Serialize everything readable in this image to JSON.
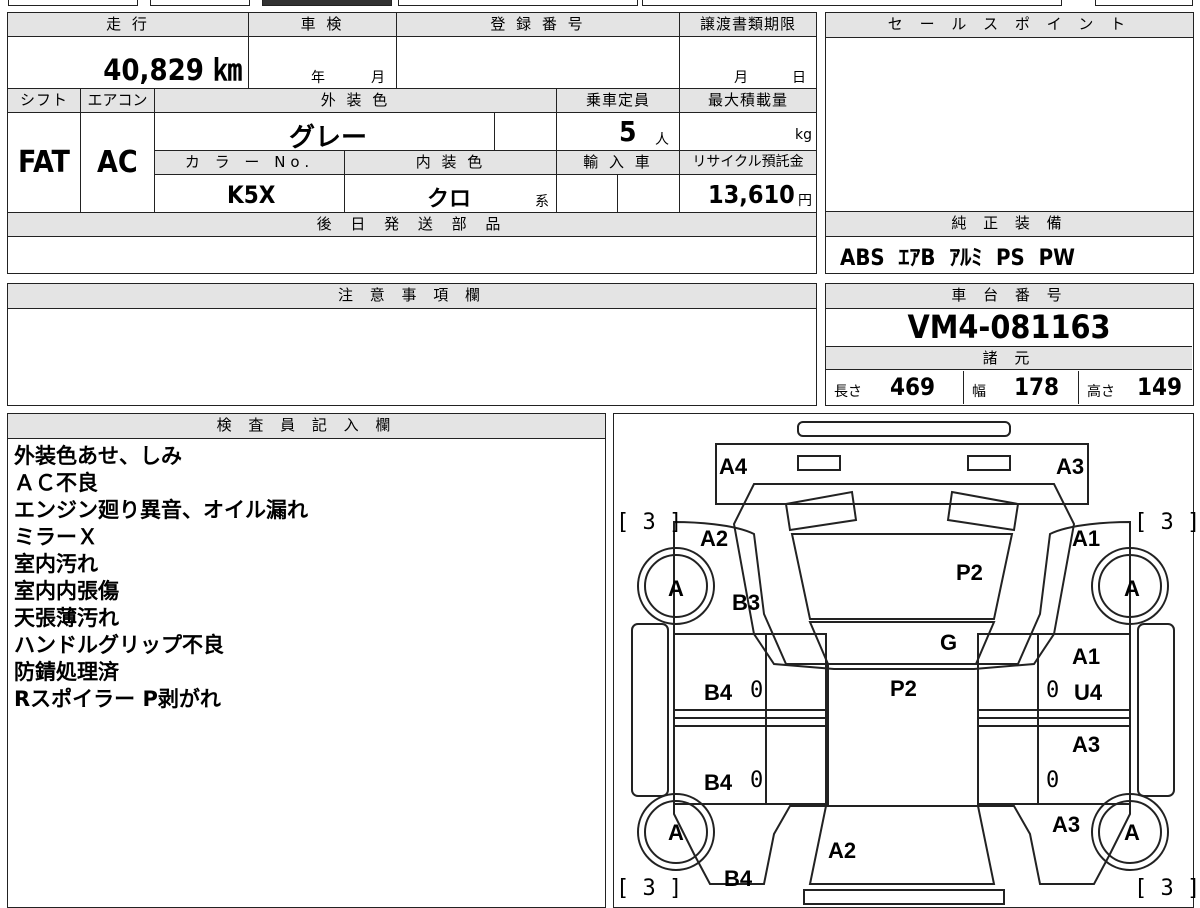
{
  "header": {
    "mileage_label": "走 行",
    "mileage_value": "40,829 ㎞",
    "shaken_label": "車 検",
    "shaken_year": "年",
    "shaken_month": "月",
    "registration_label": "登 録 番 号",
    "transfer_label": "譲渡書類期限",
    "transfer_month": "月",
    "transfer_day": "日"
  },
  "specs": {
    "shift_label": "シフト",
    "shift_value": "FAT",
    "ac_label": "エアコン",
    "ac_value": "AC",
    "exterior_label": "外 装 色",
    "exterior_value": "グレー",
    "capacity_label": "乗車定員",
    "capacity_value": "5",
    "capacity_unit": "人",
    "maxload_label": "最大積載量",
    "maxload_unit": "kg",
    "color_no_label": "カ ラ ー No.",
    "color_no_value": "K5X",
    "interior_label": "内 装 色",
    "interior_value": "クロ",
    "interior_suffix": "系",
    "import_label": "輸 入 車",
    "recycle_label": "リサイクル預託金",
    "recycle_value": "13,610",
    "recycle_unit": "円"
  },
  "later_parts_label": "後 日 発 送 部 品",
  "caution_label": "注 意 事 項 欄",
  "sales_point_label": "セ ー ル ス ポ イ ン ト",
  "equipment": {
    "label": "純 正 装 備",
    "value": "ABS  ｴｱB  ｱﾙﾐ  PS  PW"
  },
  "chassis": {
    "label": "車 台 番 号",
    "value": "VM4-081163"
  },
  "dimensions": {
    "label": "諸 元",
    "length_label": "長さ",
    "length_value": "469",
    "width_label": "幅",
    "width_value": "178",
    "height_label": "高さ",
    "height_value": "149"
  },
  "inspector": {
    "label": "検 査 員 記 入 欄",
    "notes": [
      "外装色あせ、しみ",
      "ＡＣ不良",
      "エンジン廻り異音、オイル漏れ",
      "ミラーＸ",
      "室内汚れ",
      "室内内張傷",
      "天張薄汚れ",
      "ハンドルグリップ不良",
      "防錆処理済",
      "Rスポイラー P剥がれ"
    ]
  },
  "damage_map": {
    "marks": {
      "a4": "A4",
      "a3_top": "A3",
      "a2_left": "A2",
      "a1_right": "A1",
      "b3": "B3",
      "p2_hood": "P2",
      "g": "G",
      "a1_right2": "A1",
      "b4_left1": "B4",
      "p2_roof": "P2",
      "u4": "U4",
      "a3_right": "A3",
      "b4_left2": "B4",
      "a3_right2": "A3",
      "a2_rear": "A2",
      "b4_rear": "B4"
    },
    "tires": [
      "A",
      "A",
      "A",
      "A"
    ],
    "tire_depth": [
      "[ 3 ]",
      "[ 3 ]",
      "[ 3 ]",
      "[ 3 ]"
    ],
    "zeros": [
      "0",
      "0",
      "0",
      "0"
    ]
  }
}
